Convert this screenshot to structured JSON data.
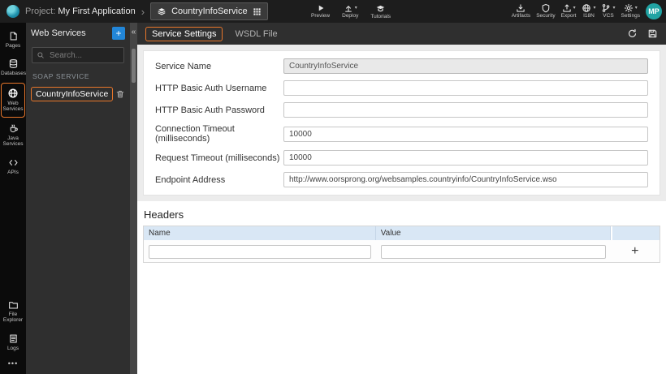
{
  "colors": {
    "accent_orange": "#e8762a",
    "accent_blue": "#2286d8",
    "avatar_teal": "#21a3a3",
    "topbar_bg": "#1d1d1d",
    "panel_bg": "#2f2f2f",
    "table_header_bg": "#d9e7f5"
  },
  "glyphs": {
    "chevron_right": "›",
    "collapse": "«",
    "caret": "▾",
    "ellipsis": "•••",
    "plus": "+"
  },
  "topbar": {
    "project_label": "Project:",
    "project_name": "My First Application",
    "service_chip": "CountryInfoService",
    "center_actions": [
      {
        "label": "Preview",
        "icon": "play-icon"
      },
      {
        "label": "Deploy",
        "icon": "deploy-icon"
      },
      {
        "label": "Tutorials",
        "icon": "tutorials-icon"
      }
    ],
    "right_actions": [
      {
        "label": "Artifacts",
        "icon": "artifacts-icon"
      },
      {
        "label": "Security",
        "icon": "security-icon"
      },
      {
        "label": "Export",
        "icon": "export-icon"
      },
      {
        "label": "I18N",
        "icon": "i18n-icon"
      },
      {
        "label": "VCS",
        "icon": "vcs-icon"
      },
      {
        "label": "Settings",
        "icon": "settings-icon"
      }
    ],
    "avatar_initials": "MP"
  },
  "activitybar": {
    "active": "Web Services",
    "items": [
      {
        "label": "Pages",
        "icon": "pages-icon"
      },
      {
        "label": "Databases",
        "icon": "databases-icon"
      },
      {
        "label": "Web Services",
        "icon": "globe-icon"
      },
      {
        "label": "Java Services",
        "icon": "java-icon"
      },
      {
        "label": "APIs",
        "icon": "apis-icon"
      },
      {
        "label": "File Explorer",
        "icon": "folder-icon"
      },
      {
        "label": "Logs",
        "icon": "logs-icon"
      }
    ]
  },
  "panel": {
    "title": "Web Services",
    "search_placeholder": "Search...",
    "section_label": "SOAP SERVICE",
    "items": [
      {
        "name": "CountryInfoService"
      }
    ]
  },
  "tabs": [
    {
      "label": "Service Settings",
      "active": true
    },
    {
      "label": "WSDL File",
      "active": false
    }
  ],
  "form": {
    "fields": [
      {
        "label": "Service Name",
        "value": "CountryInfoService",
        "readonly": true
      },
      {
        "label": "HTTP Basic Auth Username",
        "value": ""
      },
      {
        "label": "HTTP Basic Auth Password",
        "value": ""
      },
      {
        "label": "Connection Timeout (milliseconds)",
        "value": "10000"
      },
      {
        "label": "Request Timeout (milliseconds)",
        "value": "10000"
      },
      {
        "label": "Endpoint Address",
        "value": "http://www.oorsprong.org/websamples.countryinfo/CountryInfoService.wso"
      }
    ]
  },
  "headers_section": {
    "title": "Headers",
    "columns": [
      "Name",
      "Value"
    ],
    "add_label": "+"
  }
}
